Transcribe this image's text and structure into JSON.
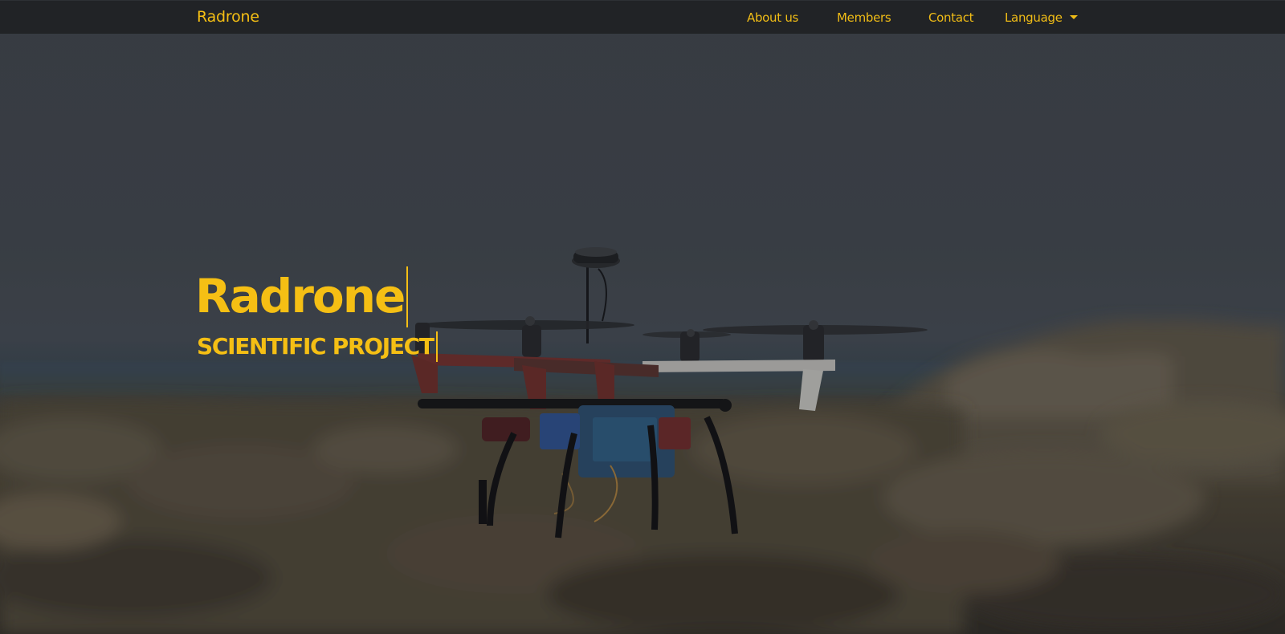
{
  "navbar": {
    "brand": "Radrone",
    "links": [
      {
        "label": "About us"
      },
      {
        "label": "Members"
      },
      {
        "label": "Contact"
      },
      {
        "label": "Language"
      }
    ]
  },
  "hero": {
    "title": "Radrone",
    "subtitle": "SCIENTIFIC PROJECT",
    "image": "quadcopter-drone-photo"
  },
  "colors": {
    "accent": "#f5bf14",
    "navbar_bg": "#212326",
    "hero_overlay": "#3f444b"
  }
}
